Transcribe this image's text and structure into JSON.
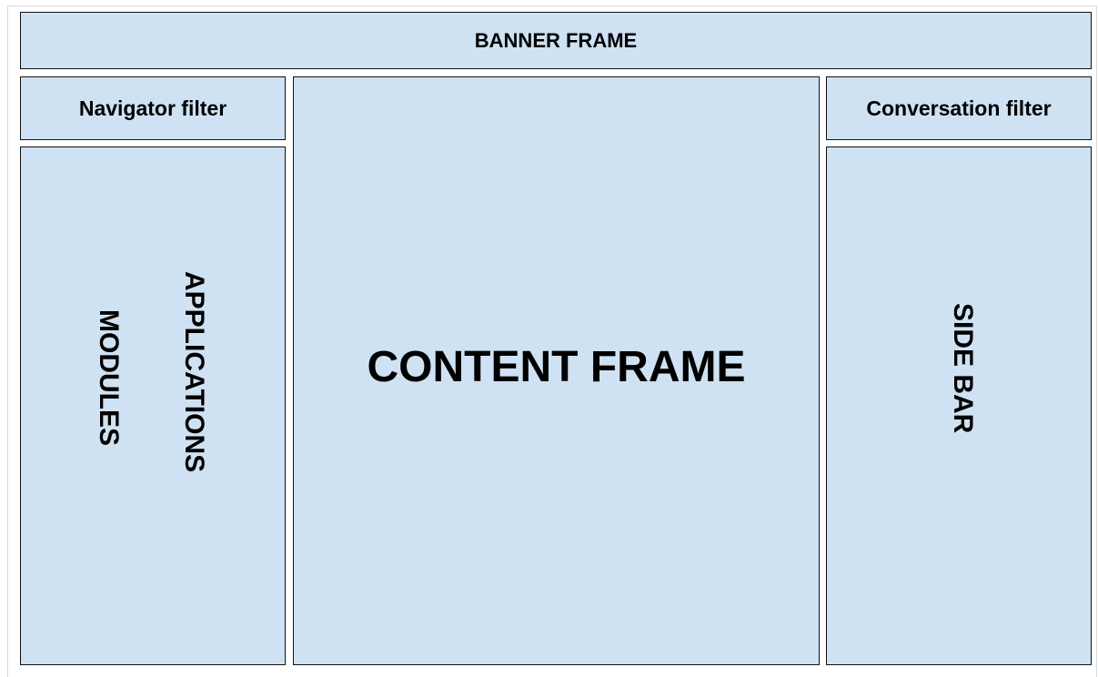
{
  "diagram": {
    "banner": "BANNER FRAME",
    "navigator_filter": "Navigator filter",
    "conversation_filter": "Conversation filter",
    "content": "CONTENT FRAME",
    "left_panel": {
      "applications": "APPLICATIONS",
      "modules": "MODULES"
    },
    "sidebar": "SIDE BAR"
  },
  "colors": {
    "box_fill": "#cfe2f3",
    "border": "#111111",
    "text": "#000000"
  }
}
